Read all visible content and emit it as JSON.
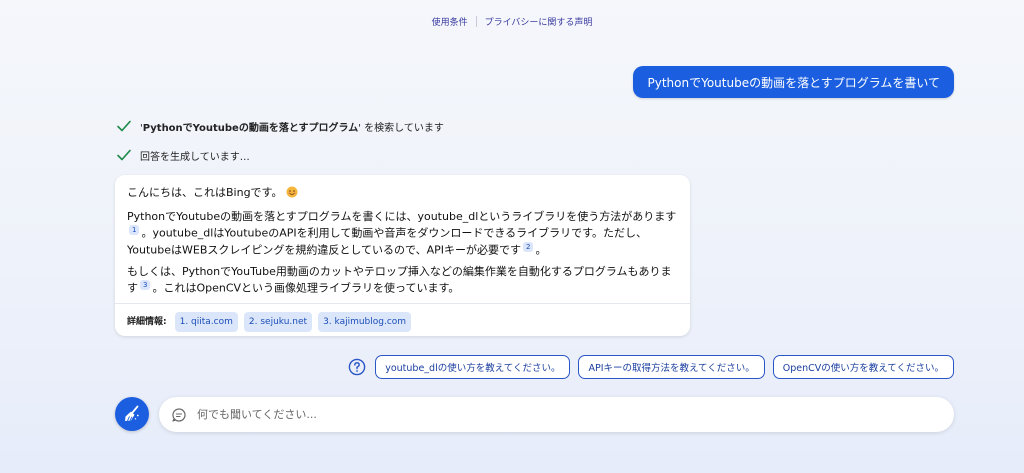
{
  "top_links": {
    "terms": "使用条件",
    "privacy": "プライバシーに関する声明"
  },
  "user_message": "PythonでYoutubeの動画を落とすプログラムを書いて",
  "status": {
    "search_prefix": "'",
    "search_query": "PythonでYoutubeの動画を落とすプログラム",
    "search_suffix": "' を検索しています",
    "generating": "回答を生成しています…"
  },
  "answer": {
    "greeting": "こんにちは、これはBingです。",
    "greeting_emoji": "smile-emoji",
    "p1_part1": "PythonでYoutubeの動画を落とすプログラムを書くには、youtube_dlというライブラリを使う方法があります",
    "p1_ref1": "1",
    "p1_part2": "。youtube_dlはYoutubeのAPIを利用して動画や音声をダウンロードできるライブラリです。ただし、YoutubeはWEBスクレイピングを規約違反としているので、APIキーが必要です",
    "p1_ref2": "2",
    "p1_part3": "。",
    "p2_part1": "もしくは、PythonでYouTube用動画のカットやテロップ挿入などの編集作業を自動化するプログラムもあります",
    "p2_ref3": "3",
    "p2_part2": "。これはOpenCVという画像処理ライブラリを使っています。",
    "sources_label": "詳細情報:",
    "sources": [
      "1. qiita.com",
      "2. sejuku.net",
      "3. kajimublog.com"
    ]
  },
  "suggestions": [
    "youtube_dlの使い方を教えてください。",
    "APIキーの取得方法を教えてください。",
    "OpenCVの使い方を教えてください。"
  ],
  "input": {
    "placeholder": "何でも聞いてください..."
  },
  "colors": {
    "accent": "#1b5fe0",
    "check": "#1f8a4c",
    "chip_bg": "#dce6fb"
  },
  "icons": {
    "status": "check-icon",
    "suggestions": "help-circle-icon",
    "new_topic": "broom-icon",
    "input": "chat-bubble-icon"
  }
}
